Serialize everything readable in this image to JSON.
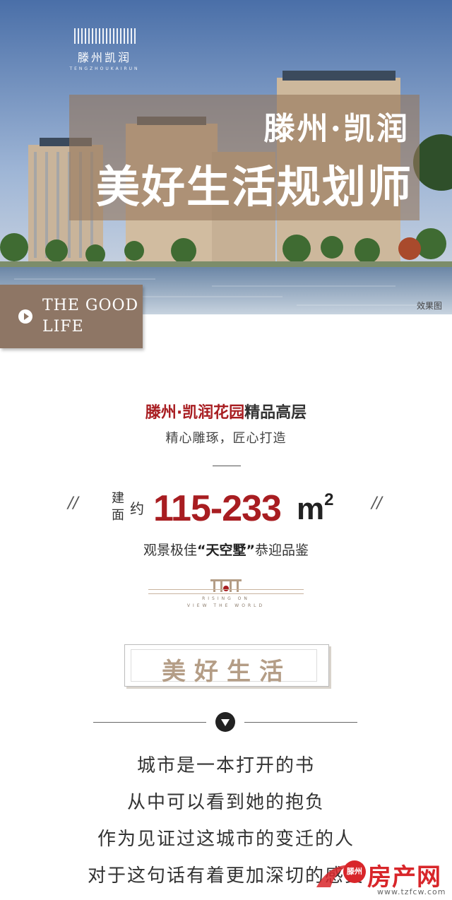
{
  "hero": {
    "logo_cn": "滕州凯润",
    "logo_en": "TENGZHOUKAIRUN",
    "title_line1": "滕州·凯润",
    "title_line2": "美好生活规划师",
    "render_note": "效果图",
    "badge_text_1": "THE GOOD",
    "badge_text_2": "LIFE"
  },
  "info": {
    "project_name_red": "滕州·凯润花园",
    "project_name_dark": "精品高层",
    "tagline": "精心雕琢，匠心打造",
    "label_jian": "建",
    "label_mian": "面",
    "label_yue": "约",
    "area_range": "115-233",
    "area_unit": "m",
    "area_unit_sup": "2",
    "slash": "//",
    "view_prefix": "观景极佳",
    "view_highlight": "“天空墅”",
    "view_suffix": "恭迎品鉴",
    "emblem_line1": "RISING ON",
    "emblem_line2": "VIEW THE WORLD"
  },
  "section": {
    "title": "美好生活"
  },
  "poem": {
    "lines": [
      "城市是一本打开的书",
      "从中可以看到她的抱负",
      "作为见证过这城市的变迁的人",
      "对于这句话有着更加深切的感受"
    ]
  },
  "watermark": {
    "badge": "滕州",
    "name": "房产网",
    "url": "www.tzfcw.com"
  },
  "colors": {
    "brand_red": "#a81d21",
    "title_box": "#96785c",
    "badge_brown": "#8e7665",
    "section_gold": "#b49d86"
  }
}
